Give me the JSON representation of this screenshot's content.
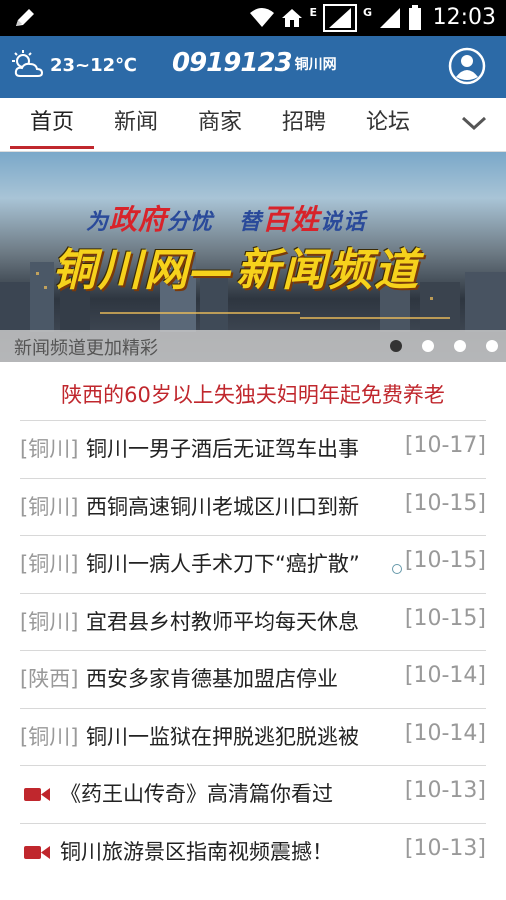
{
  "status_bar": {
    "time": "12:03",
    "network_letters": [
      "E",
      "G"
    ],
    "icons": [
      "pen-icon",
      "wifi-icon",
      "home-icon",
      "signal-icon",
      "signal-icon",
      "battery-icon"
    ]
  },
  "header": {
    "temperature": "23~12℃",
    "weather_icon": "cloudy-sun-icon",
    "logo_number": "0919123",
    "logo_text": "铜川网",
    "user_icon": "user-icon",
    "background": "#2c6aa7"
  },
  "nav": {
    "tabs": [
      "首页",
      "新闻",
      "商家",
      "招聘",
      "论坛"
    ],
    "active_index": 0,
    "more_icon": "chevron-down-icon",
    "accent": "#c0272d"
  },
  "banner": {
    "slogan_part1_small": "为",
    "slogan_part1_big": "政府",
    "slogan_part1_end": "分忧",
    "slogan_part2_small": "替",
    "slogan_part2_big": "百姓",
    "slogan_part2_end": "说话",
    "headline": "铜川网—新闻频道",
    "caption": "新闻频道更加精彩",
    "slides": 4,
    "active_slide": 0
  },
  "headline_news": "陕西的60岁以上失独夫妇明年起免费养老",
  "news": [
    {
      "tag": "[铜川]",
      "title": "铜川一男子酒后无证驾车出事",
      "date": "[10-17]"
    },
    {
      "tag": "[铜川]",
      "title": "西铜高速铜川老城区川口到新",
      "date": "[10-15]"
    },
    {
      "tag": "[铜川]",
      "title": "铜川一病人手术刀下“癌扩散”",
      "date": "[10-15]"
    },
    {
      "tag": "[铜川]",
      "title": "宜君县乡村教师平均每天休息",
      "date": "[10-15]"
    },
    {
      "tag": "[陕西]",
      "title": "西安多家肯德基加盟店停业",
      "date": "[10-14]"
    },
    {
      "tag": "[铜川]",
      "title": "铜川一监狱在押脱逃犯脱逃被",
      "date": "[10-14]"
    }
  ],
  "videos": [
    {
      "title": "《药王山传奇》高清篇你看过",
      "date": "[10-13]",
      "icon": "video-camera-icon"
    },
    {
      "title": "铜川旅游景区指南视频震撼！",
      "date": "[10-13]",
      "icon": "video-camera-icon"
    }
  ]
}
